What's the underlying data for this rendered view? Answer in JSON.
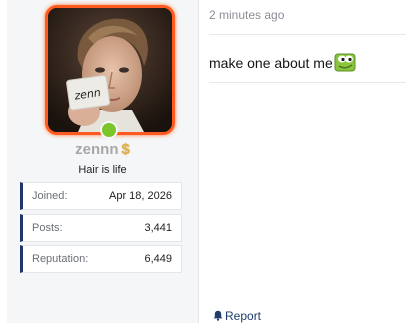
{
  "user": {
    "username": "zennn",
    "rank_icon": "dollar-icon",
    "rank_glyph": "$",
    "title": "Hair is life",
    "avatar_card_text": "zenn",
    "online_color": "#7bc42a",
    "avatar_border_color": "#ff5a1f"
  },
  "stats": [
    {
      "label": "Joined:",
      "value": "Apr 18, 2026"
    },
    {
      "label": "Posts:",
      "value": "3,441"
    },
    {
      "label": "Reputation:",
      "value": "6,449"
    }
  ],
  "post": {
    "timestamp": "2 minutes ago",
    "message": "make one about me",
    "emoji_icon": "pepe-frog-emoji-icon"
  },
  "actions": {
    "report_label": "Report",
    "report_icon": "bell-icon"
  },
  "colors": {
    "stat_accent": "#22346b",
    "link": "#1f3c6e"
  }
}
